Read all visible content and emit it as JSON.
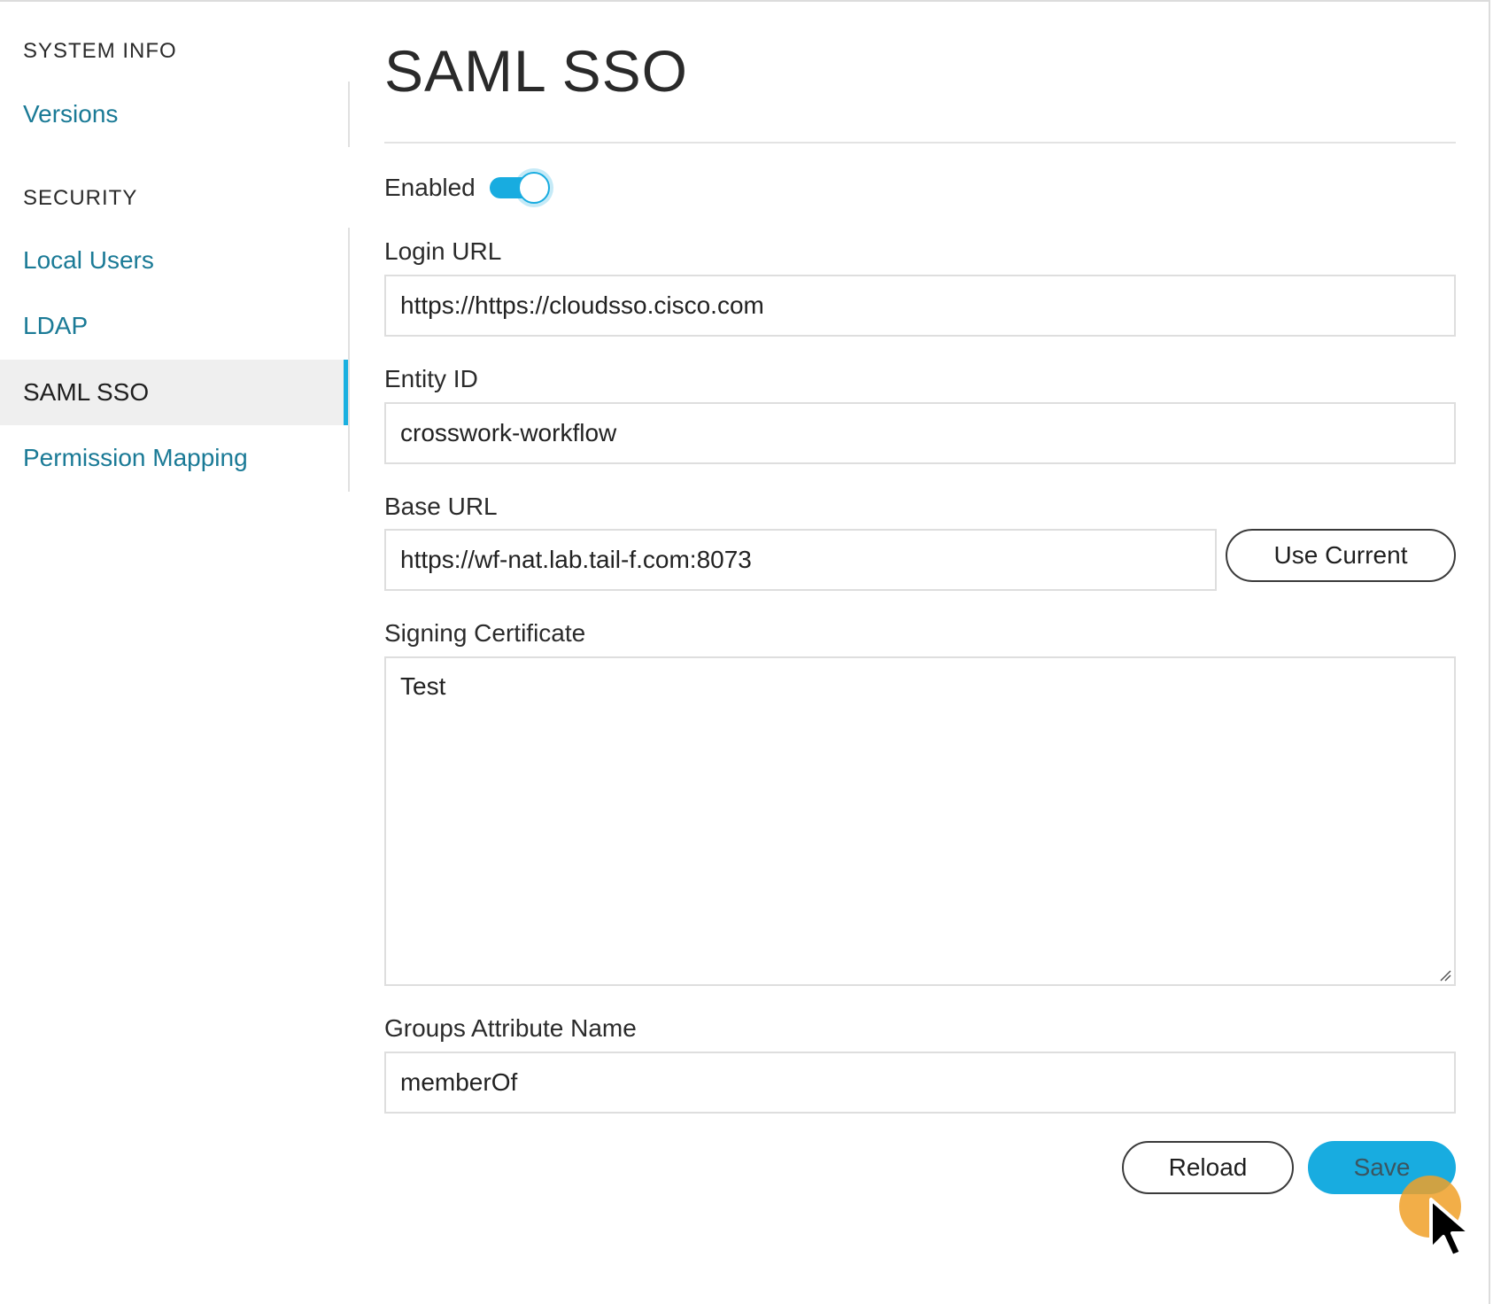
{
  "sidebar": {
    "sections": [
      {
        "heading": "SYSTEM INFO",
        "items": [
          {
            "label": "Versions",
            "active": false
          }
        ]
      },
      {
        "heading": "SECURITY",
        "items": [
          {
            "label": "Local Users",
            "active": false
          },
          {
            "label": "LDAP",
            "active": false
          },
          {
            "label": "SAML SSO",
            "active": true
          },
          {
            "label": "Permission Mapping",
            "active": false
          }
        ]
      }
    ]
  },
  "main": {
    "title": "SAML SSO",
    "enabled": {
      "label": "Enabled",
      "value": true
    },
    "login_url": {
      "label": "Login URL",
      "value": "https://https://cloudsso.cisco.com"
    },
    "entity_id": {
      "label": "Entity ID",
      "value": "crosswork-workflow"
    },
    "base_url": {
      "label": "Base URL",
      "value": "https://wf-nat.lab.tail-f.com:8073",
      "use_current_label": "Use Current"
    },
    "signing_certificate": {
      "label": "Signing Certificate",
      "value": "Test"
    },
    "groups_attribute": {
      "label": "Groups Attribute Name",
      "value": "memberOf"
    },
    "actions": {
      "reload_label": "Reload",
      "save_label": "Save"
    }
  },
  "colors": {
    "accent": "#18ace0",
    "link": "#1a7a96",
    "cursor_highlight": "#f0a028"
  }
}
